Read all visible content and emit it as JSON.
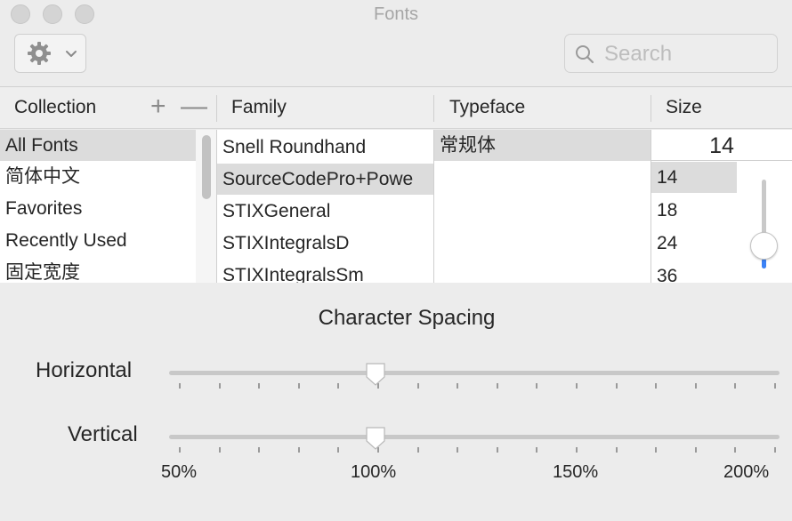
{
  "window": {
    "title": "Fonts"
  },
  "toolbar": {
    "action_icon": "gear-icon",
    "search_placeholder": "Search",
    "search_value": ""
  },
  "columns": {
    "collection": "Collection",
    "family": "Family",
    "typeface": "Typeface",
    "size": "Size",
    "add_symbol": "+",
    "remove_symbol": "—"
  },
  "collections": [
    "All Fonts",
    "简体中文",
    "Favorites",
    "Recently Used",
    "固定宽度"
  ],
  "collections_selected": "All Fonts",
  "families": [
    "Snell Roundhand",
    "SourceCodePro+Powe",
    "STIXGeneral",
    "STIXIntegralsD",
    "STIXIntegralsSm"
  ],
  "families_selected": "SourceCodePro+Powe",
  "typefaces": [
    "常规体"
  ],
  "typefaces_selected": "常规体",
  "size": {
    "current": "14",
    "options": [
      "14",
      "18",
      "24",
      "36"
    ],
    "selected": "14"
  },
  "character_spacing": {
    "title": "Character Spacing",
    "horizontal_label": "Horizontal",
    "vertical_label": "Vertical",
    "horizontal_value": "100%",
    "vertical_value": "100%",
    "scale_labels": [
      "50%",
      "100%",
      "150%",
      "200%"
    ]
  }
}
